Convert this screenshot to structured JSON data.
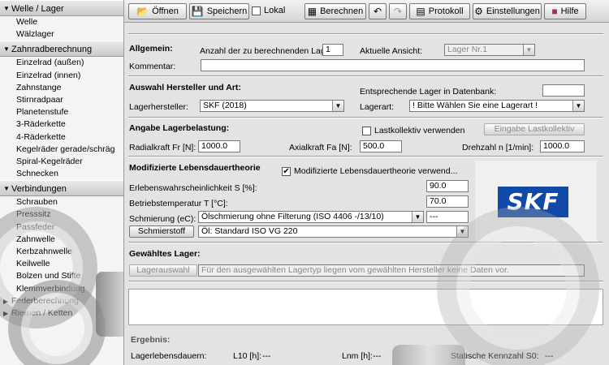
{
  "sidebar": {
    "sections": [
      {
        "title": "Welle / Lager",
        "items": [
          "Welle",
          "Wälzlager"
        ]
      },
      {
        "title": "Zahnradberechnung",
        "items": [
          "Einzelrad (außen)",
          "Einzelrad (innen)",
          "Zahnstange",
          "Stirnradpaar",
          "Planetenstufe",
          "3-Räderkette",
          "4-Räderkette",
          "Kegelräder gerade/schräg",
          "Spiral-Kegelräder",
          "Schnecken"
        ]
      },
      {
        "title": "Verbindungen",
        "items": [
          "Schrauben",
          "Presssitz",
          "Passfeder",
          "Zahnwelle",
          "Kerbzahnwelle",
          "Keilwelle",
          "Bolzen und Stifte",
          "Klemmverbindung"
        ]
      },
      {
        "title": "Federberechnung",
        "items": []
      },
      {
        "title": "Riemen / Ketten",
        "items": []
      }
    ]
  },
  "toolbar": {
    "open": "Öffnen",
    "save": "Speichern",
    "local": "Lokal",
    "calc": "Berechnen",
    "undo_icon": "undo-icon",
    "redo_icon": "redo-icon",
    "protocol": "Protokoll",
    "settings": "Einstellungen",
    "help": "Hilfe"
  },
  "general": {
    "title": "Allgemein:",
    "count_label": "Anzahl der zu berechnenden Lager:",
    "count_value": "1",
    "view_label": "Aktuelle Ansicht:",
    "view_value": "Lager Nr.1",
    "comment_label": "Kommentar:",
    "comment_value": ""
  },
  "manufacturer": {
    "title": "Auswahl Hersteller und Art:",
    "db_label": "Entsprechende Lager in Datenbank:",
    "db_value": "",
    "maker_label": "Lagerhersteller:",
    "maker_value": "SKF (2018)",
    "type_label": "Lagerart:",
    "type_value": "! Bitte Wählen Sie eine Lagerart !"
  },
  "load": {
    "title": "Angabe Lagerbelastung:",
    "collective_label": "Lastkollektiv verwenden",
    "collective_btn": "Eingabe Lastkollektiv",
    "radial_label": "Radialkraft Fr [N]:",
    "radial_value": "1000.0",
    "axial_label": "Axialkraft Fa [N]:",
    "axial_value": "500.0",
    "speed_label": "Drehzahl n [1/min]:",
    "speed_value": "1000.0"
  },
  "life": {
    "title": "Modifizierte Lebensdauertheorie",
    "check_label": "Modifizierte Lebensdauertheorie verwend...",
    "prob_label": "Erlebenswahrscheinlichkeit S [%]:",
    "prob_value": "90.0",
    "temp_label": "Betriebstemperatur T [°C]:",
    "temp_value": "70.0",
    "lube_label": "Schmierung (eC):",
    "lube_value": "Ölschmierung ohne Filterung (ISO 4406 -/13/10)",
    "lube_extra": "---",
    "lubricant_btn": "Schmierstoff",
    "lubricant_value": "Öl:  Standard ISO VG 220",
    "brand": "SKF"
  },
  "selected": {
    "title": "Gewähltes Lager:",
    "btn": "Lagerauswahl",
    "message": "Für den ausgewählten Lagertyp liegen vom gewählten Hersteller keine Daten vor."
  },
  "result": {
    "title": "Ergebnis:",
    "life_label": "Lagerlebensdauern:",
    "l10_label": "L10 [h]:",
    "l10_value": "---",
    "lnm_label": "Lnm [h]:",
    "lnm_value": "---",
    "static_label": "Statische Kennzahl S0:",
    "static_value": "---"
  }
}
